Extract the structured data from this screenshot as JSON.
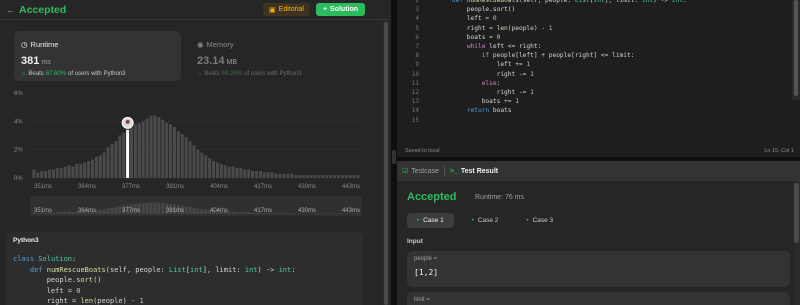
{
  "header": {
    "status": "Accepted",
    "editorial_label": "Editorial",
    "solution_label": "Solution"
  },
  "runtime": {
    "title": "Runtime",
    "value": "381",
    "unit": "ms",
    "beats_prefix": "Beats",
    "beats_pct": "67.60%",
    "beats_suffix": "of users with Python3"
  },
  "memory": {
    "title": "Memory",
    "value": "23.14",
    "unit": "MB",
    "beats_prefix": "Beats",
    "beats_pct": "69.28%",
    "beats_suffix": "of users with Python3"
  },
  "chart_data": {
    "type": "bar",
    "y_ticks": [
      "6%",
      "4%",
      "2%",
      "0%"
    ],
    "ylim": [
      0,
      6
    ],
    "x_ticks": [
      "351ms",
      "364ms",
      "377ms",
      "391ms",
      "404ms",
      "417ms",
      "430ms",
      "443ms"
    ],
    "values": [
      0.6,
      0.4,
      0.5,
      0.5,
      0.6,
      0.6,
      0.7,
      0.7,
      0.8,
      0.9,
      0.8,
      1.0,
      1.0,
      1.1,
      1.2,
      1.3,
      1.5,
      1.6,
      1.8,
      2.2,
      2.4,
      2.6,
      3.0,
      3.2,
      3.4,
      3.6,
      3.8,
      3.9,
      4.0,
      4.2,
      4.4,
      4.4,
      4.3,
      4.1,
      3.9,
      3.8,
      3.6,
      3.3,
      3.1,
      2.9,
      2.6,
      2.3,
      2.0,
      1.8,
      1.6,
      1.4,
      1.2,
      1.1,
      1.0,
      0.9,
      0.8,
      0.8,
      0.7,
      0.7,
      0.6,
      0.6,
      0.5,
      0.5,
      0.5,
      0.4,
      0.4,
      0.4,
      0.3,
      0.3,
      0.3,
      0.3,
      0.3,
      0.2,
      0.2,
      0.2,
      0.2,
      0.2,
      0.2,
      0.2,
      0.2,
      0.2,
      0.2,
      0.2,
      0.2,
      0.2,
      0.2,
      0.2,
      0.2,
      0.2
    ],
    "highlight_index": 24,
    "mini_ticks": [
      "351ms",
      "364ms",
      "377ms",
      "391ms",
      "404ms",
      "417ms",
      "430ms",
      "443ms"
    ]
  },
  "code_preview": {
    "language": "Python3",
    "lines": [
      "class Solution:",
      "    def numRescueBoats(self, people: List[int], limit: int) -> int:",
      "        people.sort()",
      "        left = 0",
      "        right = len(people) - 1"
    ]
  },
  "editor": {
    "line_numbers": [
      "2",
      "3",
      "4",
      "5",
      "6",
      "7",
      "8",
      "9",
      "10",
      "11",
      "12",
      "13",
      "14",
      "15"
    ],
    "lines": [
      "    def numRescueBoats(self, people: List[int], limit: int) -> int:",
      "        people.sort()",
      "        left = 0",
      "        right = len(people) - 1",
      "        boats = 0",
      "        while left <= right:",
      "            if people[left] + people[right] <= limit:",
      "                left += 1",
      "                right -= 1",
      "            else:",
      "                right -= 1",
      "            boats += 1",
      "        return boats",
      ""
    ],
    "footer_left": "Saved to local",
    "footer_right": "Ln 15, Col 1"
  },
  "result": {
    "tab_testcase": "Testcase",
    "tab_result": "Test Result",
    "status": "Accepted",
    "runtime_text": "Runtime: 76 ms",
    "cases": [
      "Case 1",
      "Case 2",
      "Case 3"
    ],
    "input_label": "Input",
    "inputs": [
      {
        "name": "people =",
        "value": "[1,2]"
      },
      {
        "name": "limit =",
        "value": ""
      }
    ]
  },
  "colors": {
    "accent_green": "#2cbb5d",
    "editorial_text": "#ffb800",
    "bar": "#4a4a4a",
    "bar_highlight": "#ffffff"
  }
}
